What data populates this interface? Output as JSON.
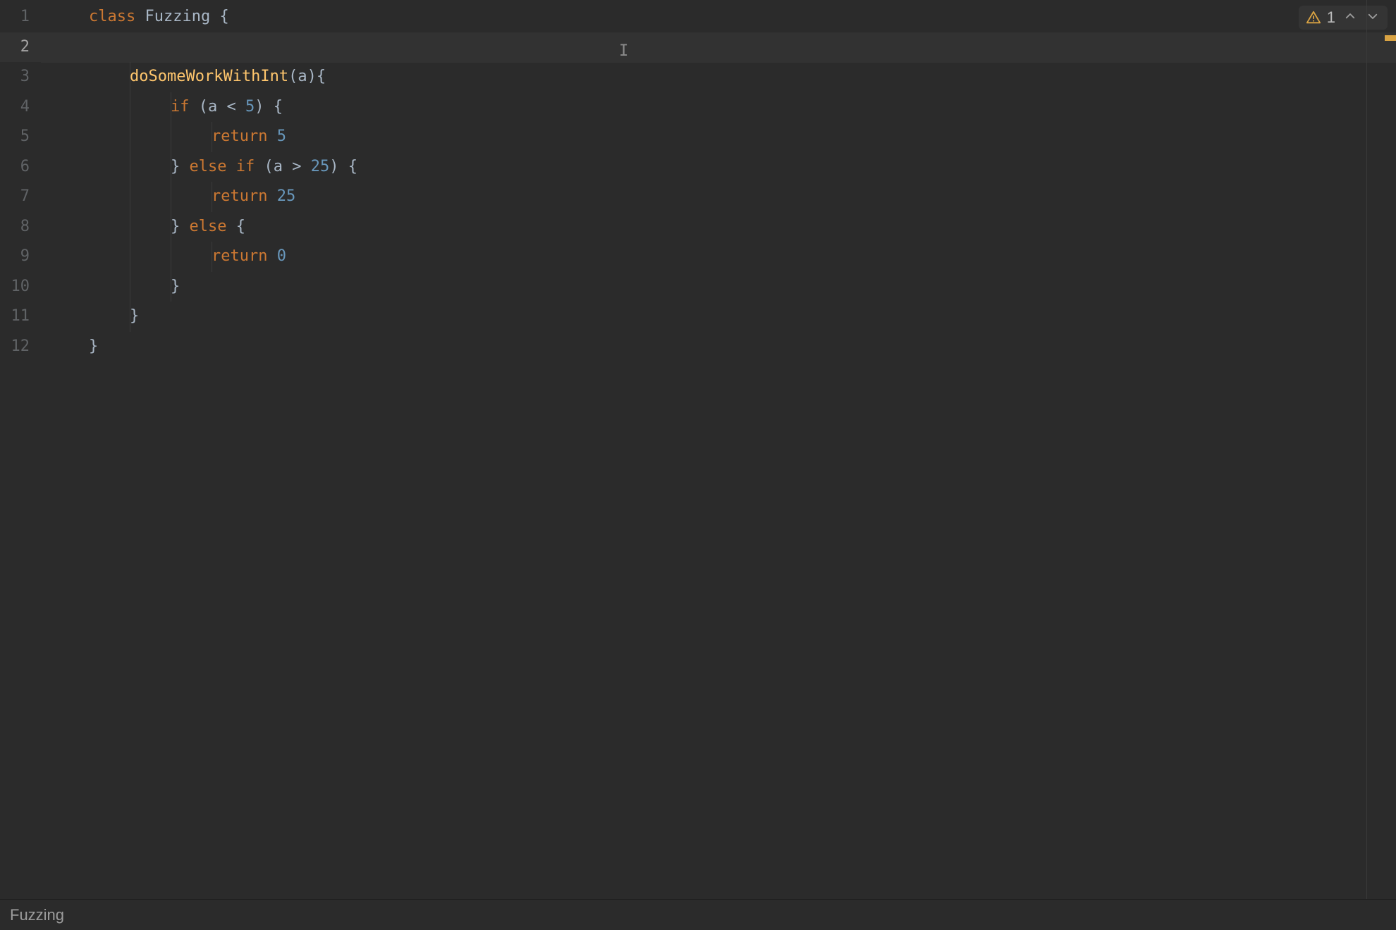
{
  "colors": {
    "bg": "#2b2b2b",
    "keyword": "#cc7832",
    "method": "#ffc66d",
    "number": "#6897bb",
    "default": "#a9b7c6",
    "gutter": "#606366",
    "warning": "#d9a343"
  },
  "editor": {
    "current_line_index": 1,
    "line_numbers": [
      "1",
      "2",
      "3",
      "4",
      "5",
      "6",
      "7",
      "8",
      "9",
      "10",
      "11",
      "12"
    ],
    "lines": [
      {
        "indent": 1,
        "tokens": [
          {
            "t": "class ",
            "c": "tok-keyword"
          },
          {
            "t": "Fuzzing ",
            "c": "tok-ident"
          },
          {
            "t": "{",
            "c": "tok-punct"
          }
        ]
      },
      {
        "indent": 0,
        "tokens": []
      },
      {
        "indent": 2,
        "tokens": [
          {
            "t": "doSomeWorkWithInt",
            "c": "tok-method"
          },
          {
            "t": "(",
            "c": "tok-punct"
          },
          {
            "t": "a",
            "c": "tok-param"
          },
          {
            "t": "){",
            "c": "tok-punct"
          }
        ]
      },
      {
        "indent": 3,
        "tokens": [
          {
            "t": "if ",
            "c": "tok-keyword"
          },
          {
            "t": "(",
            "c": "tok-punct"
          },
          {
            "t": "a ",
            "c": "tok-ident"
          },
          {
            "t": "< ",
            "c": "tok-punct"
          },
          {
            "t": "5",
            "c": "tok-number"
          },
          {
            "t": ") {",
            "c": "tok-punct"
          }
        ]
      },
      {
        "indent": 4,
        "tokens": [
          {
            "t": "return ",
            "c": "tok-keyword"
          },
          {
            "t": "5",
            "c": "tok-number"
          }
        ]
      },
      {
        "indent": 3,
        "tokens": [
          {
            "t": "} ",
            "c": "tok-punct"
          },
          {
            "t": "else if ",
            "c": "tok-keyword"
          },
          {
            "t": "(",
            "c": "tok-punct"
          },
          {
            "t": "a ",
            "c": "tok-ident"
          },
          {
            "t": "> ",
            "c": "tok-punct"
          },
          {
            "t": "25",
            "c": "tok-number"
          },
          {
            "t": ") {",
            "c": "tok-punct"
          }
        ]
      },
      {
        "indent": 4,
        "tokens": [
          {
            "t": "return ",
            "c": "tok-keyword"
          },
          {
            "t": "25",
            "c": "tok-number"
          }
        ]
      },
      {
        "indent": 3,
        "tokens": [
          {
            "t": "} ",
            "c": "tok-punct"
          },
          {
            "t": "else ",
            "c": "tok-keyword"
          },
          {
            "t": "{",
            "c": "tok-punct"
          }
        ]
      },
      {
        "indent": 4,
        "tokens": [
          {
            "t": "return ",
            "c": "tok-keyword"
          },
          {
            "t": "0",
            "c": "tok-number"
          }
        ]
      },
      {
        "indent": 3,
        "tokens": [
          {
            "t": "}",
            "c": "tok-punct"
          }
        ]
      },
      {
        "indent": 2,
        "tokens": [
          {
            "t": "}",
            "c": "tok-punct"
          }
        ]
      },
      {
        "indent": 1,
        "tokens": [
          {
            "t": "}",
            "c": "tok-punct"
          }
        ]
      }
    ]
  },
  "inspections": {
    "warning_count": "1",
    "icon": "warning-triangle-icon"
  },
  "breadcrumbs": {
    "items": [
      "Fuzzing"
    ]
  },
  "caret_glyph": "I"
}
